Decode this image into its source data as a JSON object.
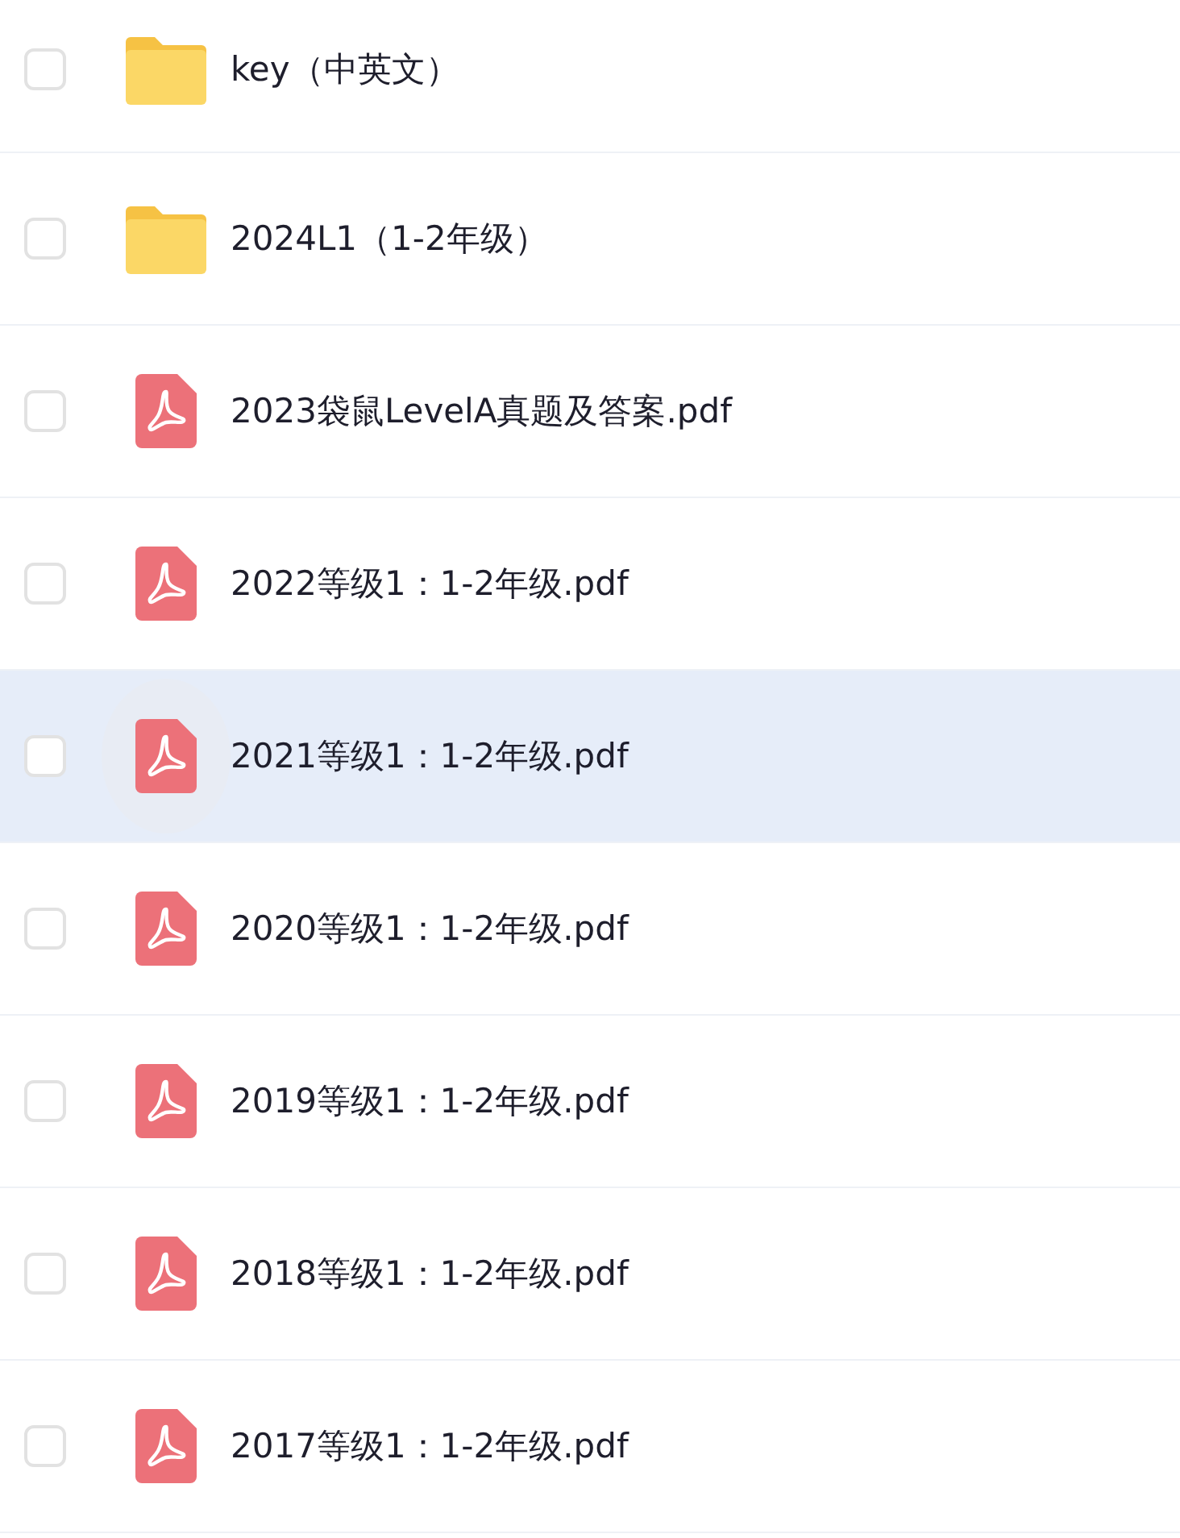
{
  "files": [
    {
      "kind": "folder",
      "name": "key（中英文）",
      "checked": false,
      "hovered": false
    },
    {
      "kind": "folder",
      "name": "2024L1（1-2年级）",
      "checked": false,
      "hovered": false
    },
    {
      "kind": "pdf",
      "name": "2023袋鼠LevelA真题及答案.pdf",
      "checked": false,
      "hovered": false
    },
    {
      "kind": "pdf",
      "name": "2022等级1：1-2年级.pdf",
      "checked": false,
      "hovered": false
    },
    {
      "kind": "pdf",
      "name": "2021等级1：1-2年级.pdf",
      "checked": false,
      "hovered": true
    },
    {
      "kind": "pdf",
      "name": "2020等级1：1-2年级.pdf",
      "checked": false,
      "hovered": false
    },
    {
      "kind": "pdf",
      "name": "2019等级1：1-2年级.pdf",
      "checked": false,
      "hovered": false
    },
    {
      "kind": "pdf",
      "name": "2018等级1：1-2年级.pdf",
      "checked": false,
      "hovered": false
    },
    {
      "kind": "pdf",
      "name": "2017等级1：1-2年级.pdf",
      "checked": false,
      "hovered": false
    }
  ]
}
